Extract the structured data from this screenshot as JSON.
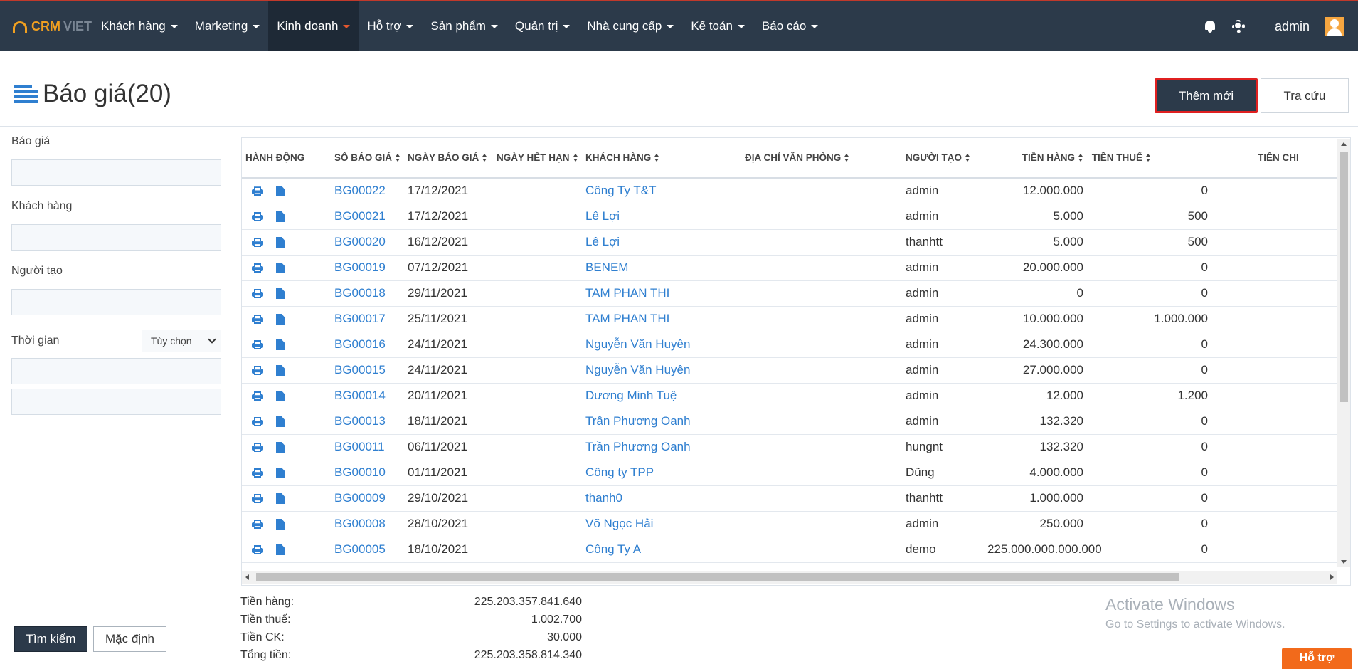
{
  "logo": {
    "part1": "CRM",
    "part2": "VIET"
  },
  "nav": [
    {
      "label": "Khách hàng"
    },
    {
      "label": "Marketing"
    },
    {
      "label": "Kinh doanh"
    },
    {
      "label": "Hỗ trợ"
    },
    {
      "label": "Sản phẩm"
    },
    {
      "label": "Quản trị"
    },
    {
      "label": "Nhà cung cấp"
    },
    {
      "label": "Kế toán"
    },
    {
      "label": "Báo cáo"
    }
  ],
  "user": {
    "name": "admin"
  },
  "page": {
    "title": "Báo giá(20)",
    "add_button": "Thêm mới",
    "lookup_button": "Tra cứu"
  },
  "filter": {
    "quote_label": "Báo giá",
    "customer_label": "Khách hàng",
    "creator_label": "Người tạo",
    "time_label": "Thời gian",
    "time_option": "Tùy chọn",
    "search_button": "Tìm kiếm",
    "default_button": "Mặc định"
  },
  "table": {
    "headers": {
      "action": "HÀNH ĐỘNG",
      "number": "SỐ BÁO GIÁ",
      "date": "NGÀY BÁO GIÁ",
      "expiry": "NGÀY HẾT HẠN",
      "customer": "KHÁCH HÀNG",
      "address": "ĐỊA CHỈ VĂN PHÒNG",
      "creator": "NGƯỜI TẠO",
      "goods": "TIỀN HÀNG",
      "tax": "TIỀN THUẾ",
      "discount": "TIỀN CHI"
    },
    "rows": [
      {
        "number": "BG00022",
        "date": "17/12/2021",
        "customer": "Công Ty T&T",
        "creator": "admin",
        "goods": "12.000.000",
        "tax": "0"
      },
      {
        "number": "BG00021",
        "date": "17/12/2021",
        "customer": "Lê Lợi",
        "creator": "admin",
        "goods": "5.000",
        "tax": "500"
      },
      {
        "number": "BG00020",
        "date": "16/12/2021",
        "customer": "Lê Lợi",
        "creator": "thanhtt",
        "goods": "5.000",
        "tax": "500"
      },
      {
        "number": "BG00019",
        "date": "07/12/2021",
        "customer": "BENEM",
        "creator": "admin",
        "goods": "20.000.000",
        "tax": "0"
      },
      {
        "number": "BG00018",
        "date": "29/11/2021",
        "customer": "TAM PHAN THI",
        "creator": "admin",
        "goods": "0",
        "tax": "0"
      },
      {
        "number": "BG00017",
        "date": "25/11/2021",
        "customer": "TAM PHAN THI",
        "creator": "admin",
        "goods": "10.000.000",
        "tax": "1.000.000"
      },
      {
        "number": "BG00016",
        "date": "24/11/2021",
        "customer": "Nguyễn Văn Huyên",
        "creator": "admin",
        "goods": "24.300.000",
        "tax": "0"
      },
      {
        "number": "BG00015",
        "date": "24/11/2021",
        "customer": "Nguyễn Văn Huyên",
        "creator": "admin",
        "goods": "27.000.000",
        "tax": "0"
      },
      {
        "number": "BG00014",
        "date": "20/11/2021",
        "customer": "Dương Minh Tuệ",
        "creator": "admin",
        "goods": "12.000",
        "tax": "1.200"
      },
      {
        "number": "BG00013",
        "date": "18/11/2021",
        "customer": "Trần Phương Oanh",
        "creator": "admin",
        "goods": "132.320",
        "tax": "0"
      },
      {
        "number": "BG00011",
        "date": "06/11/2021",
        "customer": "Trần Phương Oanh",
        "creator": "hungnt",
        "goods": "132.320",
        "tax": "0"
      },
      {
        "number": "BG00010",
        "date": "01/11/2021",
        "customer": "Công ty TPP",
        "creator": "Dũng",
        "goods": "4.000.000",
        "tax": "0"
      },
      {
        "number": "BG00009",
        "date": "29/10/2021",
        "customer": "thanh0",
        "creator": "thanhtt",
        "goods": "1.000.000",
        "tax": "0"
      },
      {
        "number": "BG00008",
        "date": "28/10/2021",
        "customer": "Võ Ngọc Hải",
        "creator": "admin",
        "goods": "250.000",
        "tax": "0"
      },
      {
        "number": "BG00005",
        "date": "18/10/2021",
        "customer": "Công Ty A",
        "creator": "demo",
        "goods": "225.000.000.000.000",
        "tax": "0"
      }
    ]
  },
  "totals": {
    "goods_label": "Tiền hàng:",
    "goods_value": "225.203.357.841.640",
    "tax_label": "Tiền thuế:",
    "tax_value": "1.002.700",
    "discount_label": "Tiền CK:",
    "discount_value": "30.000",
    "total_label": "Tổng tiền:",
    "total_value": "225.203.358.814.340"
  },
  "windows": {
    "line1": "Activate Windows",
    "line2": "Go to Settings to activate Windows."
  },
  "support_button": "Hỗ trợ",
  "colors": {
    "nav_bg": "#2c3a4a",
    "accent": "#f0a020",
    "link": "#2f7fd0",
    "support": "#f26a1b"
  }
}
